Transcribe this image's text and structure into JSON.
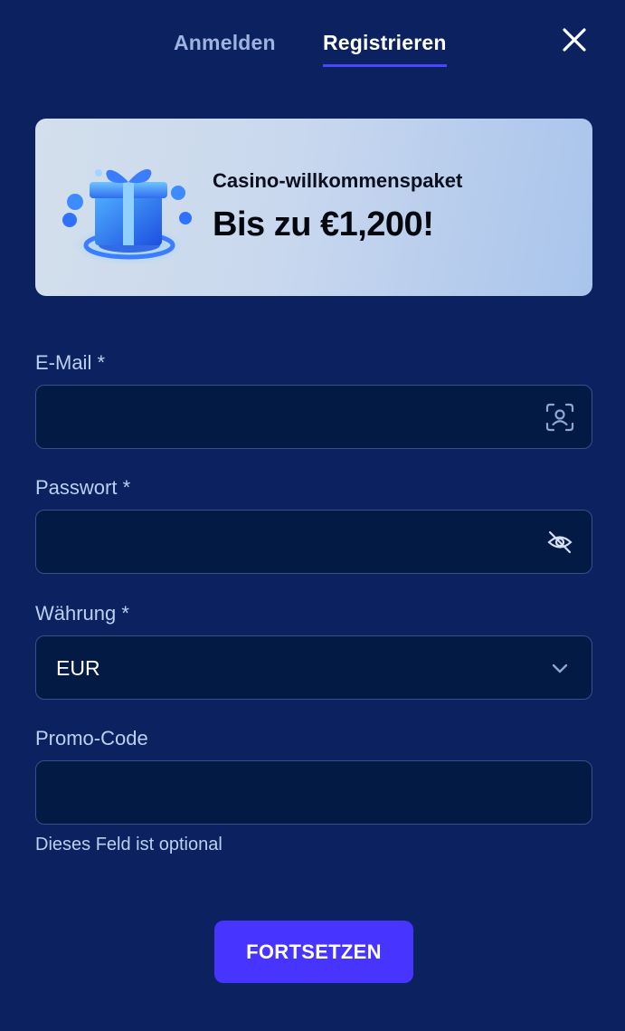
{
  "tabs": {
    "login_label": "Anmelden",
    "register_label": "Registrieren",
    "active": "register"
  },
  "banner": {
    "subtitle": "Casino-willkommenspaket",
    "title": "Bis zu €1,200!",
    "image": "gift-box-icon"
  },
  "form": {
    "email": {
      "label": "E-Mail *",
      "value": "",
      "icon": "face-id-user-icon"
    },
    "password": {
      "label": "Passwort *",
      "value": "",
      "icon": "eye-off-icon"
    },
    "currency": {
      "label": "Währung *",
      "value": "EUR",
      "icon": "chevron-down-icon"
    },
    "promo": {
      "label": "Promo-Code",
      "value": "",
      "hint": "Dieses Feld ist optional"
    },
    "submit_label": "FORTSETZEN"
  },
  "colors": {
    "background": "#0b2160",
    "field_bg": "#031a45",
    "accent": "#4734ff",
    "label": "#bcd0f0"
  }
}
